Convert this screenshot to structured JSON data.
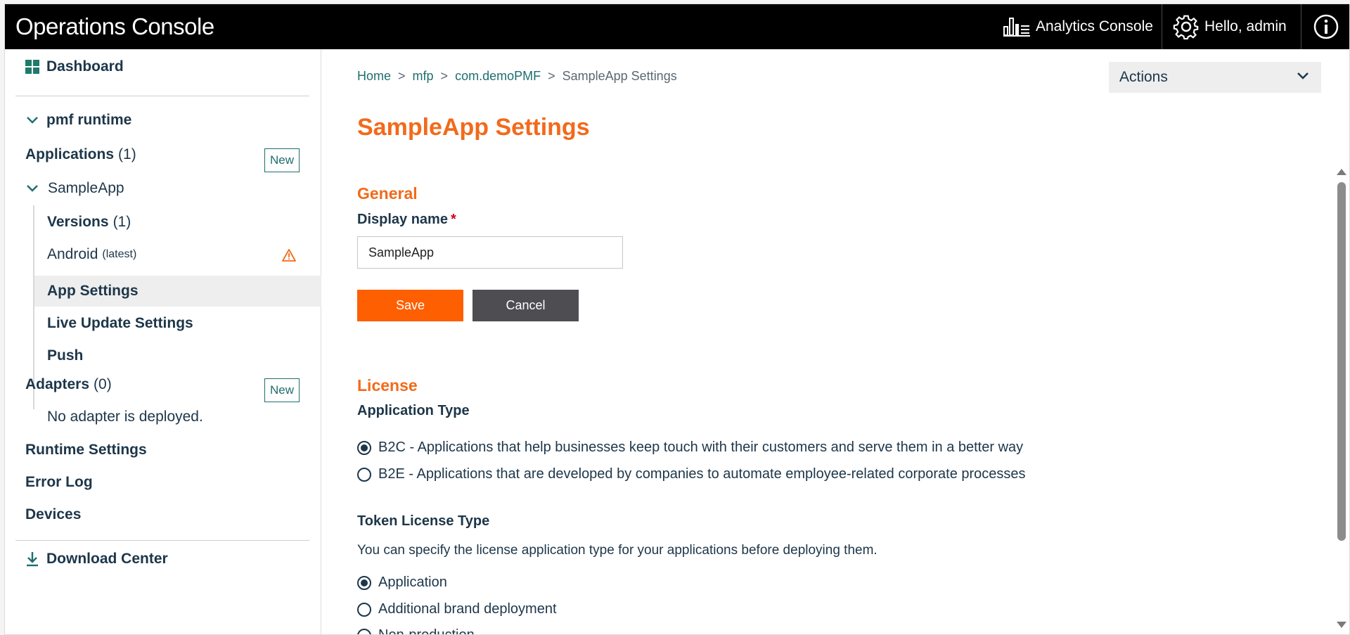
{
  "header": {
    "title": "Operations Console",
    "analytics_label": "Analytics Console",
    "user_label": "Hello, admin"
  },
  "sidebar": {
    "dashboard": "Dashboard",
    "runtime": "pmf runtime",
    "applications": {
      "label": "Applications",
      "count": "(1)",
      "new_label": "New"
    },
    "app": {
      "name": "SampleApp",
      "versions": {
        "label": "Versions",
        "count": "(1)"
      },
      "android": {
        "label": "Android",
        "sub": "(latest)"
      },
      "app_settings": "App Settings",
      "live_update": "Live Update Settings",
      "push": "Push"
    },
    "adapters": {
      "label": "Adapters",
      "count": "(0)",
      "new_label": "New",
      "empty": "No adapter is deployed."
    },
    "runtime_settings": "Runtime Settings",
    "error_log": "Error Log",
    "devices": "Devices",
    "download_center": "Download Center"
  },
  "breadcrumb": {
    "items": [
      "Home",
      "mfp",
      "com.demoPMF"
    ],
    "current": "SampleApp Settings",
    "separator": ">"
  },
  "actions": {
    "label": "Actions"
  },
  "page": {
    "title": "SampleApp Settings",
    "general": {
      "title": "General",
      "display_name_label": "Display name",
      "required_mark": "*",
      "display_name_value": "SampleApp",
      "save_label": "Save",
      "cancel_label": "Cancel"
    },
    "license": {
      "title": "License",
      "app_type_label": "Application Type",
      "app_type_options": [
        {
          "label": "B2C - Applications that help businesses keep touch with their customers and serve them in a better way",
          "checked": true
        },
        {
          "label": "B2E - Applications that are developed by companies to automate employee-related corporate processes",
          "checked": false
        }
      ],
      "token_label": "Token License Type",
      "token_description": "You can specify the license application type for your applications before deploying them.",
      "token_options": [
        {
          "label": "Application",
          "checked": true
        },
        {
          "label": "Additional brand deployment",
          "checked": false
        },
        {
          "label": "Non-production",
          "checked": false
        }
      ]
    }
  },
  "colors": {
    "accent_orange": "#f26a1b",
    "save_button": "#fe5f00",
    "cancel_button": "#4d4d52",
    "nav_text": "#1d3649",
    "link_teal": "#1f6e6e",
    "topbar": "#000000",
    "warning": "#f26a1b"
  },
  "icons": {
    "dashboard": "grid-icon",
    "analytics": "bar-chart-icon",
    "user": "gear-icon",
    "info": "info-icon",
    "collapse": "chevron-down-icon",
    "warning": "warning-icon",
    "download": "download-icon"
  }
}
